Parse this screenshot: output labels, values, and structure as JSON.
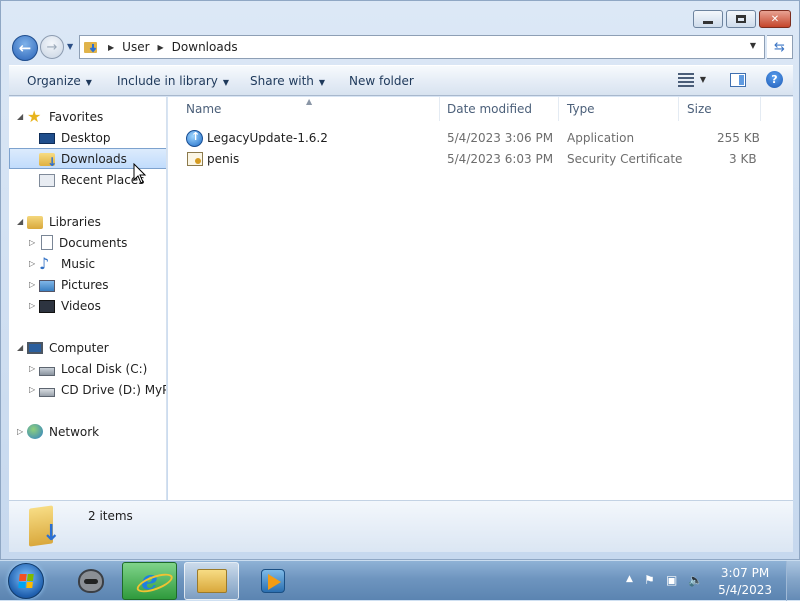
{
  "address": {
    "crumbs": [
      "User",
      "Downloads"
    ]
  },
  "toolbar": {
    "organize": "Organize",
    "include_in_library": "Include in library",
    "share_with": "Share with",
    "new_folder": "New folder",
    "view_icon": "view-options-icon",
    "preview_pane_icon": "preview-pane-icon",
    "help_icon": "help-icon",
    "help_glyph": "?"
  },
  "nav": {
    "favorites": "Favorites",
    "desktop": "Desktop",
    "downloads": "Downloads",
    "recent_places": "Recent Places",
    "libraries": "Libraries",
    "documents": "Documents",
    "music": "Music",
    "pictures": "Pictures",
    "videos": "Videos",
    "computer": "Computer",
    "local_disk": "Local Disk (C:)",
    "cd_drive": "CD Drive (D:) MyPal(",
    "network": "Network"
  },
  "columns": {
    "name": "Name",
    "date_modified": "Date modified",
    "type": "Type",
    "size": "Size"
  },
  "files": [
    {
      "name": "LegacyUpdate-1.6.2",
      "date": "5/4/2023 3:06 PM",
      "type": "Application",
      "size": "255 KB",
      "icon": "application-icon"
    },
    {
      "name": "penis",
      "date": "5/4/2023 6:03 PM",
      "type": "Security Certificate",
      "size": "3 KB",
      "icon": "certificate-icon"
    }
  ],
  "details": {
    "item_count": "2 items"
  },
  "taskbar": {
    "clock_time": "3:07 PM",
    "clock_date": "5/4/2023",
    "pinned": [
      "raccoon-app-icon",
      "internet-explorer-icon",
      "windows-explorer-icon",
      "media-player-icon"
    ]
  },
  "colors": {
    "selection": "#c1dcfc",
    "selection_border": "#7da2ce",
    "taskbar": "#6e95bf",
    "link_text": "#1e395b"
  }
}
